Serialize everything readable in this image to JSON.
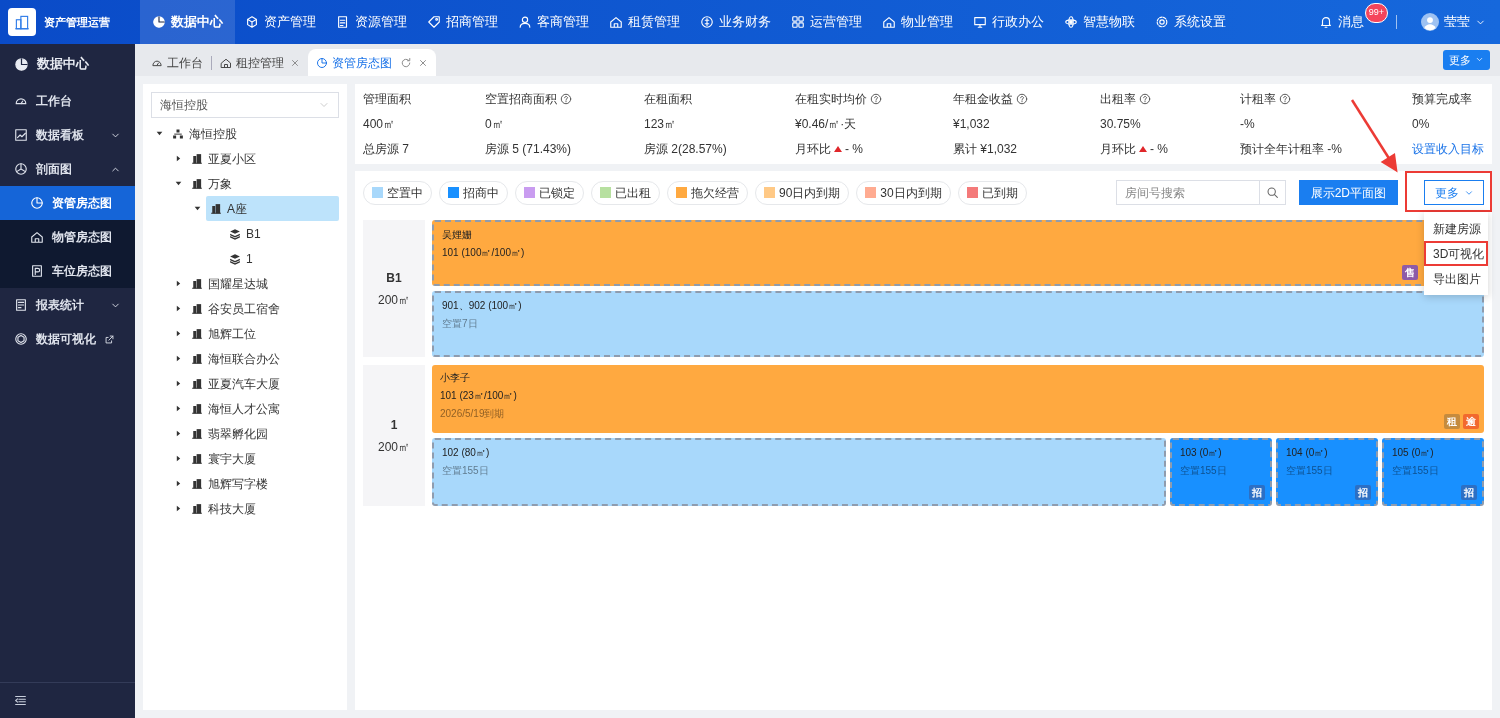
{
  "top_nav": {
    "brand": "资产管理运营",
    "items": [
      {
        "label": "数据中心",
        "selected": true
      },
      {
        "label": "资产管理",
        "selected": false
      },
      {
        "label": "资源管理",
        "selected": false
      },
      {
        "label": "招商管理",
        "selected": false
      },
      {
        "label": "客商管理",
        "selected": false
      },
      {
        "label": "租赁管理",
        "selected": false
      },
      {
        "label": "业务财务",
        "selected": false
      },
      {
        "label": "运营管理",
        "selected": false
      },
      {
        "label": "物业管理",
        "selected": false
      },
      {
        "label": "行政办公",
        "selected": false
      },
      {
        "label": "智慧物联",
        "selected": false
      },
      {
        "label": "系统设置",
        "selected": false
      }
    ],
    "notifications": {
      "label": "消息",
      "badge": "99+"
    },
    "user": {
      "name": "莹莹"
    }
  },
  "sidebar": {
    "header": "数据中心",
    "items": [
      {
        "label": "工作台",
        "kind": "link"
      },
      {
        "label": "数据看板",
        "kind": "group",
        "expanded": false
      },
      {
        "label": "剖面图",
        "kind": "group",
        "expanded": true,
        "children": [
          {
            "label": "资管房态图",
            "selected": true
          },
          {
            "label": "物管房态图",
            "selected": false
          },
          {
            "label": "车位房态图",
            "selected": false
          }
        ]
      },
      {
        "label": "报表统计",
        "kind": "group",
        "expanded": false
      },
      {
        "label": "数据可视化",
        "kind": "external"
      }
    ]
  },
  "tabs": [
    {
      "label": "工作台",
      "selected": false,
      "closable": false
    },
    {
      "label": "租控管理",
      "selected": false,
      "closable": true
    },
    {
      "label": "资管房态图",
      "selected": true,
      "closable": true
    }
  ],
  "tabs_more": "更多",
  "tree": {
    "select_value": "海恒控股",
    "nodes": [
      {
        "label": "海恒控股",
        "kind": "org",
        "expanded": true,
        "selected": false,
        "children": [
          {
            "label": "亚夏小区",
            "kind": "building",
            "expanded": false,
            "selected": false
          },
          {
            "label": "万象",
            "kind": "building",
            "expanded": true,
            "selected": false,
            "children": [
              {
                "label": "A座",
                "kind": "building",
                "expanded": true,
                "selected": true,
                "children": [
                  {
                    "label": "B1",
                    "kind": "floor",
                    "selected": false
                  },
                  {
                    "label": "1",
                    "kind": "floor",
                    "selected": false
                  }
                ]
              }
            ]
          },
          {
            "label": "国耀星达城",
            "kind": "building",
            "expanded": false,
            "selected": false
          },
          {
            "label": "谷安员工宿舍",
            "kind": "building",
            "expanded": false,
            "selected": false
          },
          {
            "label": "旭辉工位",
            "kind": "building",
            "expanded": false,
            "selected": false
          },
          {
            "label": "海恒联合办公",
            "kind": "building",
            "expanded": false,
            "selected": false
          },
          {
            "label": "亚夏汽车大厦",
            "kind": "building",
            "expanded": false,
            "selected": false
          },
          {
            "label": "海恒人才公寓",
            "kind": "building",
            "expanded": false,
            "selected": false
          },
          {
            "label": "翡翠孵化园",
            "kind": "building",
            "expanded": false,
            "selected": false
          },
          {
            "label": "寰宇大厦",
            "kind": "building",
            "expanded": false,
            "selected": false
          },
          {
            "label": "旭辉写字楼",
            "kind": "building",
            "expanded": false,
            "selected": false
          },
          {
            "label": "科技大厦",
            "kind": "building",
            "expanded": false,
            "selected": false
          }
        ]
      }
    ]
  },
  "stats": [
    {
      "label": "管理面积",
      "help": false,
      "value": "400㎡",
      "footer": {
        "kind": "text",
        "text": "总房源 7"
      }
    },
    {
      "label": "空置招商面积",
      "help": true,
      "value": "0㎡",
      "footer": {
        "kind": "text",
        "text": "房源 5 (71.43%)"
      }
    },
    {
      "label": "在租面积",
      "help": false,
      "value": "123㎡",
      "footer": {
        "kind": "text",
        "text": "房源 2(28.57%)"
      }
    },
    {
      "label": "在租实时均价",
      "help": true,
      "value": "¥0.46/㎡·天",
      "footer": {
        "kind": "trend",
        "text": "月环比",
        "rising": true,
        "change": "- %"
      }
    },
    {
      "label": "年租金收益",
      "help": true,
      "value": "¥1,032",
      "footer": {
        "kind": "text",
        "text": "累计 ¥1,032"
      }
    },
    {
      "label": "出租率",
      "help": true,
      "value": "30.75%",
      "footer": {
        "kind": "trend",
        "text": "月环比",
        "rising": true,
        "change": "- %"
      }
    },
    {
      "label": "计租率",
      "help": true,
      "value": "-%",
      "footer": {
        "kind": "text",
        "text": "预计全年计租率 -%"
      }
    },
    {
      "label": "预算完成率",
      "help": false,
      "value": "0%",
      "footer": {
        "kind": "link",
        "text": "设置收入目标"
      }
    }
  ],
  "legend": [
    {
      "label": "空置中",
      "color": "#a8d8fb"
    },
    {
      "label": "招商中",
      "color": "#1890ff"
    },
    {
      "label": "已锁定",
      "color": "#c99cf0"
    },
    {
      "label": "已出租",
      "color": "#b7e0a0"
    },
    {
      "label": "拖欠经营",
      "color": "#ffa940"
    },
    {
      "label": "90日内到期",
      "color": "#ffc986"
    },
    {
      "label": "30日内到期",
      "color": "#ffab91"
    },
    {
      "label": "已到期",
      "color": "#f47a7a"
    }
  ],
  "search": {
    "placeholder": "房间号搜索"
  },
  "plan_button": "展示2D平面图",
  "more_button": {
    "label": "更多",
    "highlighted": true,
    "open": true
  },
  "more_menu": [
    {
      "label": "新建房源",
      "highlighted": false
    },
    {
      "label": "3D可视化",
      "highlighted": true
    },
    {
      "label": "导出图片",
      "highlighted": false
    }
  ],
  "pointer_arrows": true,
  "floors": [
    {
      "name": "B1",
      "area": "200㎡",
      "rows": [
        [
          {
            "color": "#ffa940",
            "outlined": true,
            "tenant": "吴娌姗",
            "room": "101 (100㎡/100㎡)",
            "badges": [
              {
                "label": "售",
                "color": "#8e5ba8"
              }
            ]
          }
        ],
        [
          {
            "color": "#a8d8fb",
            "outlined": true,
            "room": "901、902 (100㎡)",
            "note": "空置7日"
          }
        ]
      ]
    },
    {
      "name": "1",
      "area": "200㎡",
      "rows": [
        [
          {
            "color": "#ffa940",
            "outlined": false,
            "tenant": "小李子",
            "room": "101 (23㎡/100㎡)",
            "note": "2026/5/19到期",
            "badges": [
              {
                "label": "租",
                "color": "#c58b3e"
              },
              {
                "label": "逾",
                "color": "#f2692e"
              }
            ]
          }
        ],
        [
          {
            "color": "#a8d8fb",
            "outlined": true,
            "room": "102 (80㎡)",
            "note": "空置155日"
          },
          {
            "color": "#1890ff",
            "outlined": true,
            "room": "103 (0㎡)",
            "note": "空置155日",
            "badges": [
              {
                "label": "招",
                "color": "#2c6fc4"
              }
            ]
          },
          {
            "color": "#1890ff",
            "outlined": true,
            "room": "104 (0㎡)",
            "note": "空置155日",
            "badges": [
              {
                "label": "招",
                "color": "#2c6fc4"
              }
            ]
          },
          {
            "color": "#1890ff",
            "outlined": true,
            "room": "105 (0㎡)",
            "note": "空置155日",
            "badges": [
              {
                "label": "招",
                "color": "#2c6fc4"
              }
            ]
          }
        ]
      ]
    }
  ]
}
